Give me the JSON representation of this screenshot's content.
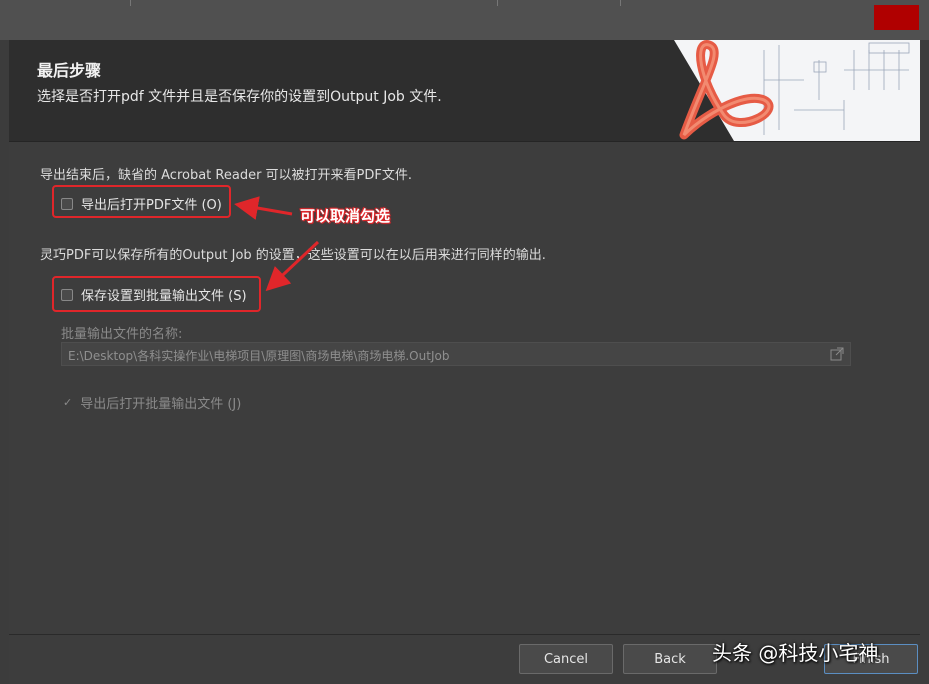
{
  "header": {
    "title": "最后步骤",
    "subtitle": "选择是否打开pdf 文件并且是否保存你的设置到Output Job 文件."
  },
  "section1": {
    "description": "导出结束后，缺省的 Acrobat Reader 可以被打开来看PDF文件.",
    "open_pdf_label": "导出后打开PDF文件 (O)",
    "open_pdf_checked": false
  },
  "section2": {
    "description": "灵巧PDF可以保存所有的Output Job 的设置，这些设置可以在以后用来进行同样的输出.",
    "save_settings_label": "保存设置到批量输出文件 (S)",
    "save_settings_checked": false,
    "batch_name_label": "批量输出文件的名称:",
    "batch_path_value": "E:\\Desktop\\各科实操作业\\电梯项目\\原理图\\商场电梯\\商场电梯.OutJob",
    "open_batch_label": "导出后打开批量输出文件 (J)",
    "open_batch_checked": true
  },
  "annotation": {
    "text": "可以取消勾选",
    "color": "#e0262a"
  },
  "buttons": {
    "cancel": "Cancel",
    "back": "Back",
    "finish": "Finish"
  },
  "watermark": "头条 @科技小宅神",
  "colors": {
    "window_bg": "#3d3d3d",
    "header_bg": "#2e2e2e",
    "highlight_red": "#e0262a",
    "top_red": "#b00000"
  },
  "icons": {
    "path_browse": "browse-path-icon",
    "checkmark": "check-icon",
    "header_art": "acrobat-logo-icon"
  }
}
